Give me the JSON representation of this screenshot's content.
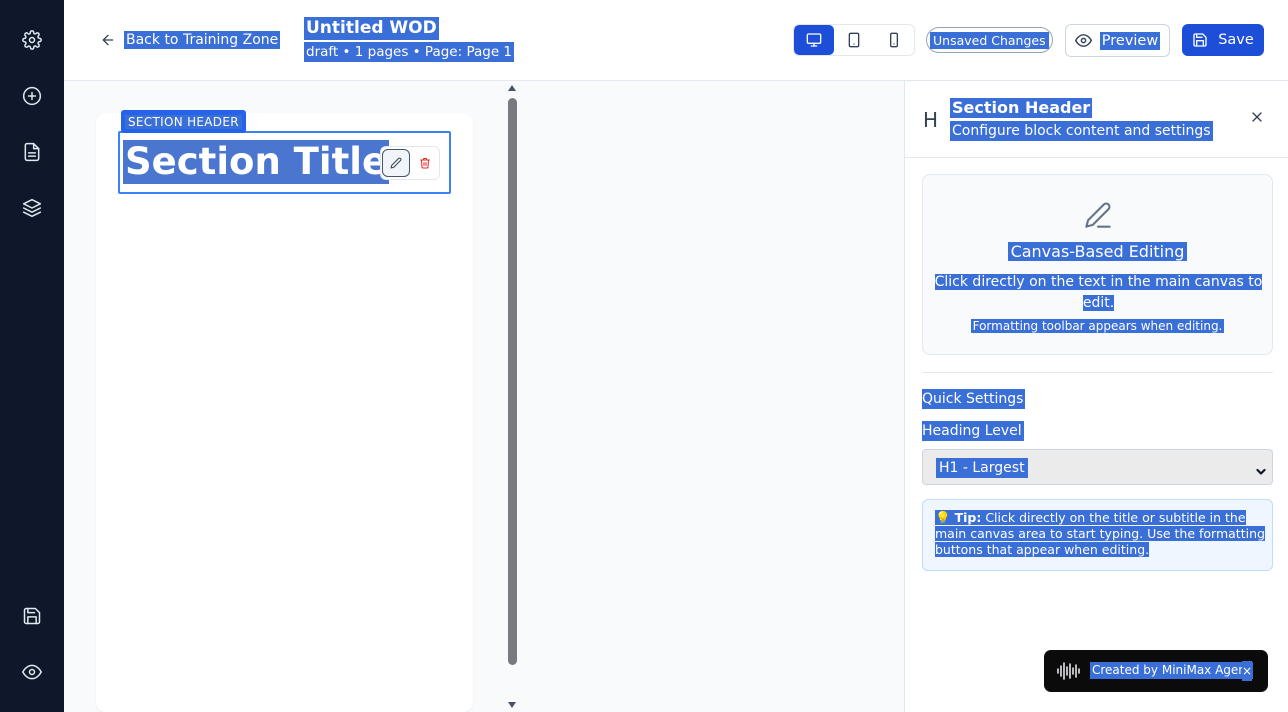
{
  "sidebar": {
    "icons": [
      "gear-icon",
      "plus-circle-icon",
      "document-icon",
      "layers-icon",
      "save-icon",
      "eye-icon"
    ]
  },
  "header": {
    "back_label": "Back to Training Zone",
    "doc_title": "Untitled WOD",
    "doc_meta": "draft • 1 pages • Page: Page 1",
    "unsaved_label": "Unsaved Changes",
    "preview_label": "Preview",
    "save_label": "Save",
    "device_modes": [
      "desktop-icon",
      "tablet-icon",
      "mobile-icon"
    ],
    "active_device": "desktop"
  },
  "canvas": {
    "block_tag": "SECTION HEADER",
    "section_title": "Section Title"
  },
  "panel": {
    "title": "Section Header",
    "subtitle": "Configure block content and settings",
    "card_title": "Canvas-Based Editing",
    "card_body": "Click directly on the text in the main canvas to edit.",
    "card_note": "Formatting toolbar appears when editing.",
    "quick_settings": "Quick Settings",
    "heading_level_label": "Heading Level",
    "heading_level_value": "H1 - Largest",
    "tip_label": "Tip:",
    "tip_text": "Click directly on the title or subtitle in the main canvas area to start typing. Use the formatting buttons that appear when editing.",
    "tip_emoji": "💡"
  },
  "toast": {
    "message": "Created by MiniMax Agent",
    "close": "×"
  },
  "colors": {
    "rail": "#0f172a",
    "accent": "#1d4ed8",
    "selection": "#3b6fd8"
  }
}
